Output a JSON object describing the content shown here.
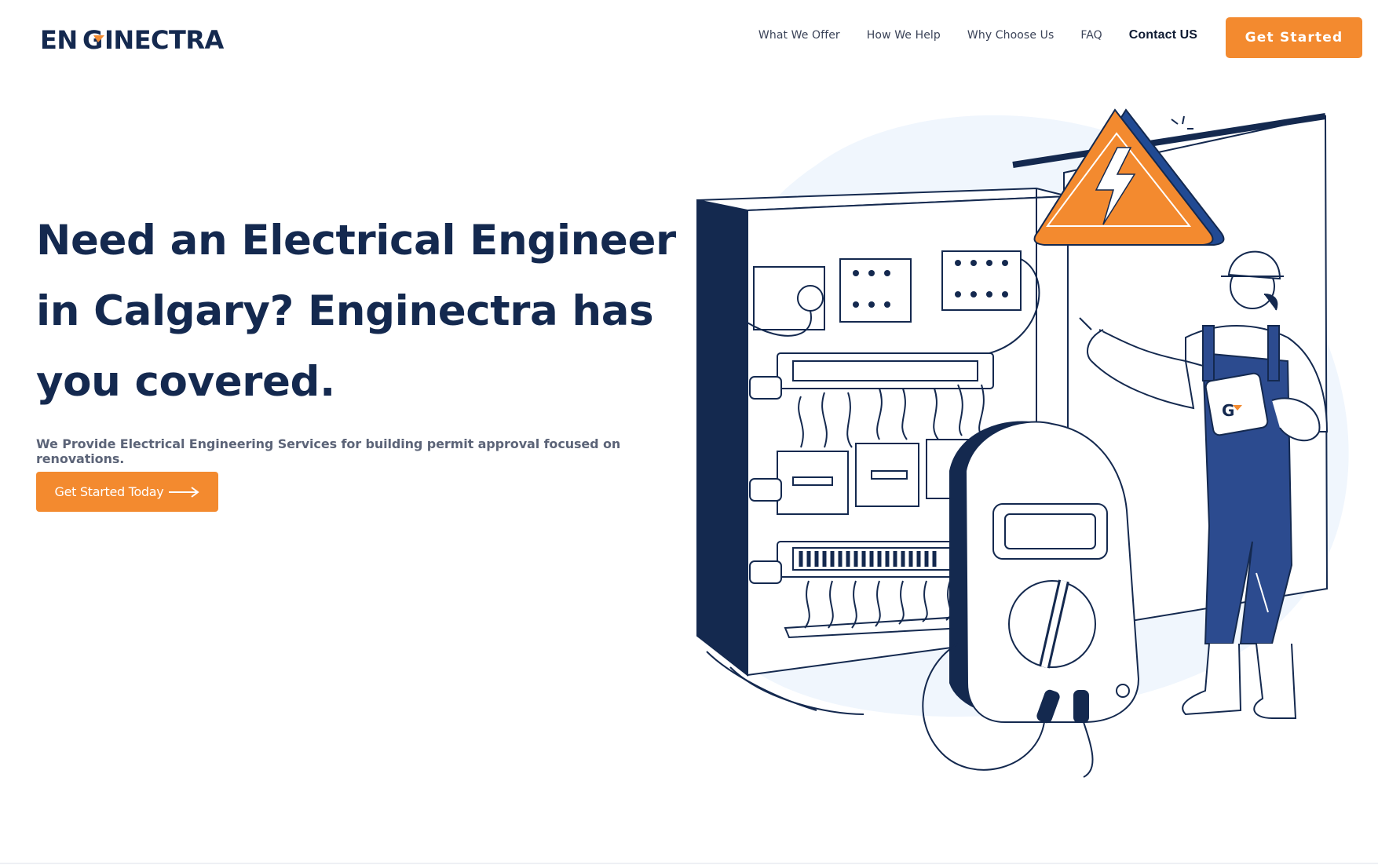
{
  "brand": {
    "logo_text": "ENGINECTRA",
    "primary_color": "#14294f",
    "accent_color": "#f38a2f"
  },
  "nav": {
    "items": [
      {
        "label": "What We Offer"
      },
      {
        "label": "How We Help"
      },
      {
        "label": "Why Choose Us"
      },
      {
        "label": "FAQ"
      },
      {
        "label": "Contact US"
      }
    ],
    "cta_label": "Get Started"
  },
  "hero": {
    "title": "Need an Electrical Engineer in Calgary? Enginectra has you covered.",
    "subtitle": "We Provide Electrical Engineering Services for building permit approval focused on renovations.",
    "cta_label": "Get Started Today",
    "cta_icon": "arrow-right-icon"
  },
  "illustration": {
    "icons": [
      "warning-electric-icon",
      "multimeter-icon",
      "electrical-panel-icon",
      "engineer-figure-icon"
    ]
  }
}
